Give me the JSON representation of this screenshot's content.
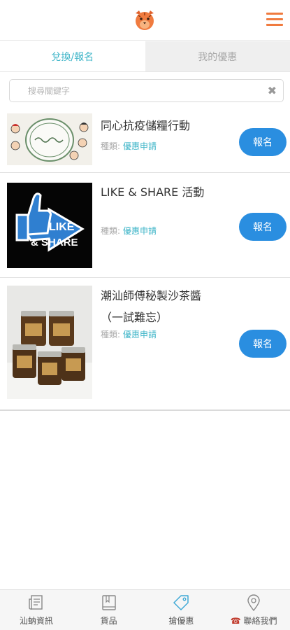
{
  "tabs": [
    {
      "label": "兌換/報名",
      "active": true
    },
    {
      "label": "我的優惠",
      "active": false
    }
  ],
  "search": {
    "placeholder": "搜尋關鍵字",
    "value": "",
    "clear_icon": "close-icon"
  },
  "items": [
    {
      "title": "同心抗疫儲糧行動",
      "category_label": "種類:",
      "category_value": "優惠申請",
      "button": "報名",
      "image": "poster with hand-drawn children faces"
    },
    {
      "title": "LIKE & SHARE 活動",
      "category_label": "種類:",
      "category_value": "優惠申請",
      "button": "報名",
      "image": "thumbs up LIKE & SHARE logo"
    },
    {
      "title": "潮汕師傅秘製沙茶醬（一試難忘）",
      "category_label": "種類:",
      "category_value": "優惠申請",
      "button": "報名",
      "image": "jars of sauce"
    }
  ],
  "thumb_texts": {
    "like": "LIKE",
    "share": "& SHARE"
  },
  "bottom_nav": [
    {
      "label": "汕蚋資訊",
      "icon": "newspaper-icon"
    },
    {
      "label": "貨品",
      "icon": "book-icon"
    },
    {
      "label": "搶優惠",
      "icon": "tag-icon",
      "active": true
    },
    {
      "label": "聯絡我們",
      "icon": "location-pin-icon",
      "prefix_icon": "telephone-icon"
    }
  ],
  "colors": {
    "accent": "#3fb5c8",
    "button": "#2a8ee0",
    "brand": "#f07b3f"
  }
}
